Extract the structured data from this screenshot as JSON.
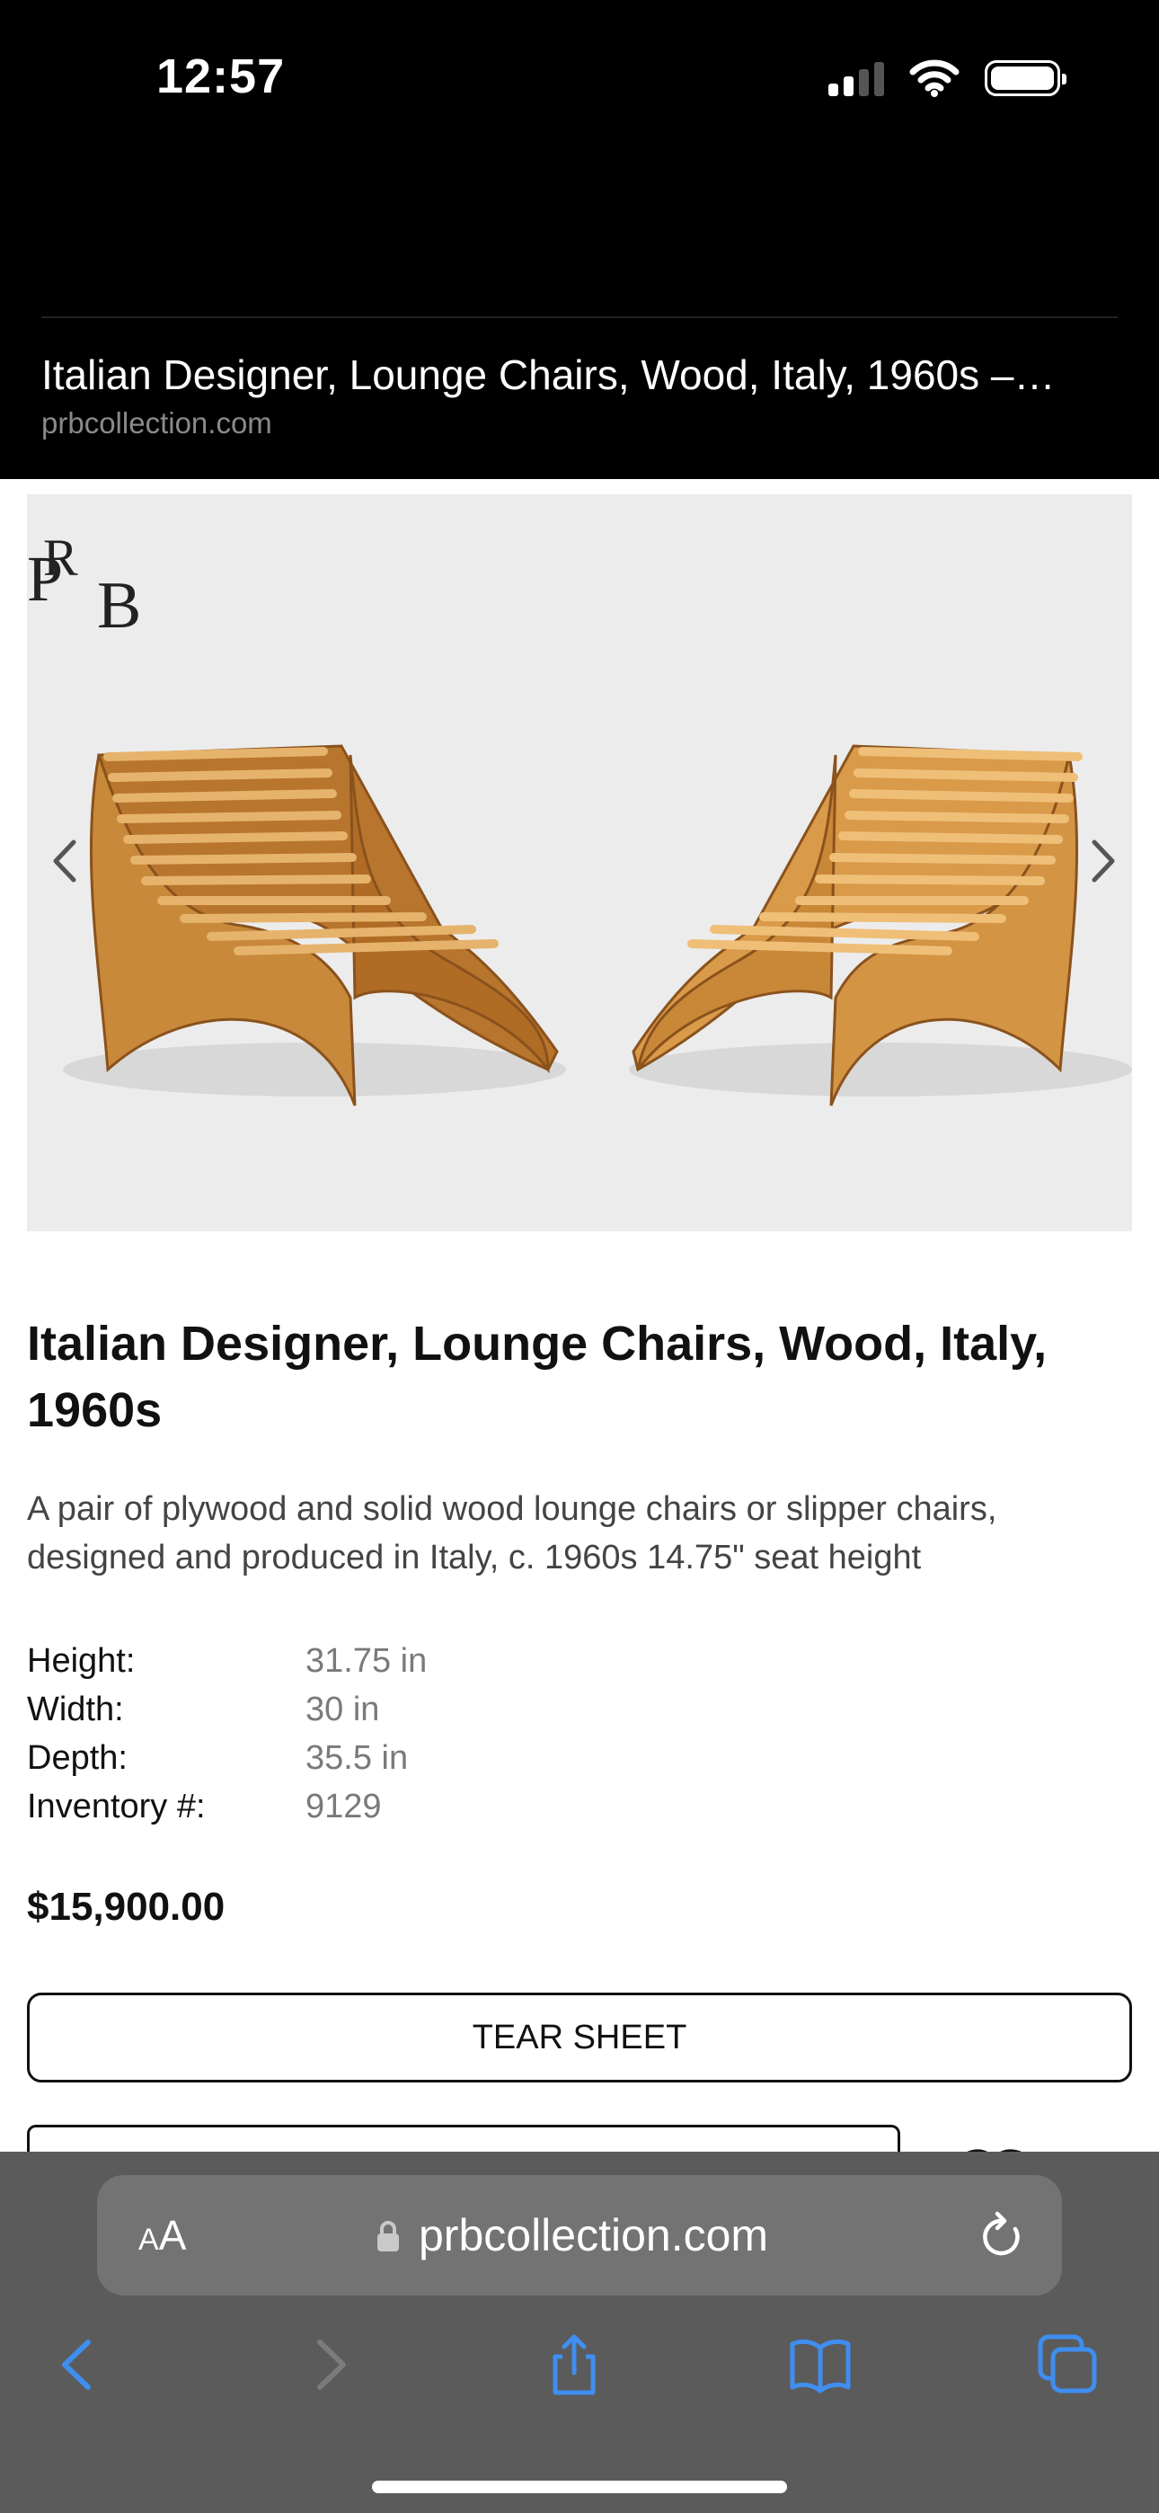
{
  "status_bar": {
    "time": "12:57",
    "signal_bars": 4,
    "signal_bars_active": 2
  },
  "page_header": {
    "title": "Italian Designer, Lounge Chairs, Wood, Italy, 1960s –…",
    "domain": "prbcollection.com"
  },
  "gallery": {
    "logo_letters": [
      "P",
      "R",
      "B"
    ],
    "prev_icon": "chevron-left-icon",
    "next_icon": "chevron-right-icon"
  },
  "product": {
    "title": "Italian Designer, Lounge Chairs, Wood, Italy, 1960s",
    "description": "A pair of plywood and solid wood lounge chairs or slipper chairs, designed and produced in Italy, c. 1960s 14.75\" seat height",
    "specs": [
      {
        "label": "Height:",
        "value": "31.75 in"
      },
      {
        "label": "Width:",
        "value": "30 in"
      },
      {
        "label": "Depth:",
        "value": "35.5 in"
      },
      {
        "label": "Inventory #:",
        "value": "9129"
      }
    ],
    "price": "$15,900.00",
    "tear_sheet_label": "TEAR SHEET"
  },
  "browser": {
    "aa_small": "A",
    "aa_large": "A",
    "url": "prbcollection.com",
    "toolbar_icons": [
      "back-icon",
      "forward-icon",
      "share-icon",
      "bookmarks-icon",
      "tabs-icon"
    ]
  },
  "colors": {
    "header_bg": "#000000",
    "gallery_bg": "#ececec",
    "toolbar_bg": "#5b5b5b",
    "toolbar_accent": "#3f8ef0",
    "wood": "#c8893a"
  }
}
